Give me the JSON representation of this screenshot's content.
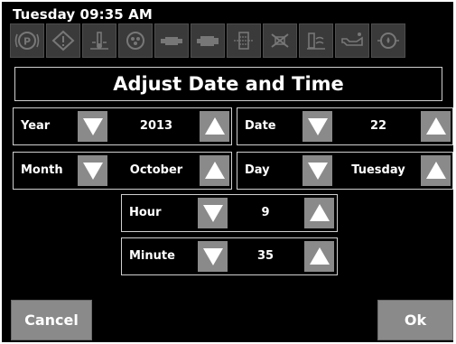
{
  "status_bar": {
    "datetime": "Tuesday 09:35 AM"
  },
  "icons": [
    "parking-brake-icon",
    "warning-triangle-icon",
    "coolant-temp-icon",
    "dpf-filter-icon",
    "glow-plug-icon",
    "engine-icon",
    "diesel-filter-icon",
    "regen-inhibit-icon",
    "water-in-fuel-icon",
    "oil-pressure-icon",
    "hydraulic-icon"
  ],
  "title": "Adjust Date and Time",
  "fields": {
    "year": {
      "label": "Year",
      "value": "2013"
    },
    "date": {
      "label": "Date",
      "value": "22"
    },
    "month": {
      "label": "Month",
      "value": "October"
    },
    "day": {
      "label": "Day",
      "value": "Tuesday"
    },
    "hour": {
      "label": "Hour",
      "value": "9"
    },
    "minute": {
      "label": "Minute",
      "value": "35"
    }
  },
  "buttons": {
    "cancel": "Cancel",
    "ok": "Ok"
  },
  "colors": {
    "background": "#000000",
    "button_gray": "#8a8a8a",
    "icon_bg": "#3a3a3a",
    "text": "#ffffff"
  }
}
